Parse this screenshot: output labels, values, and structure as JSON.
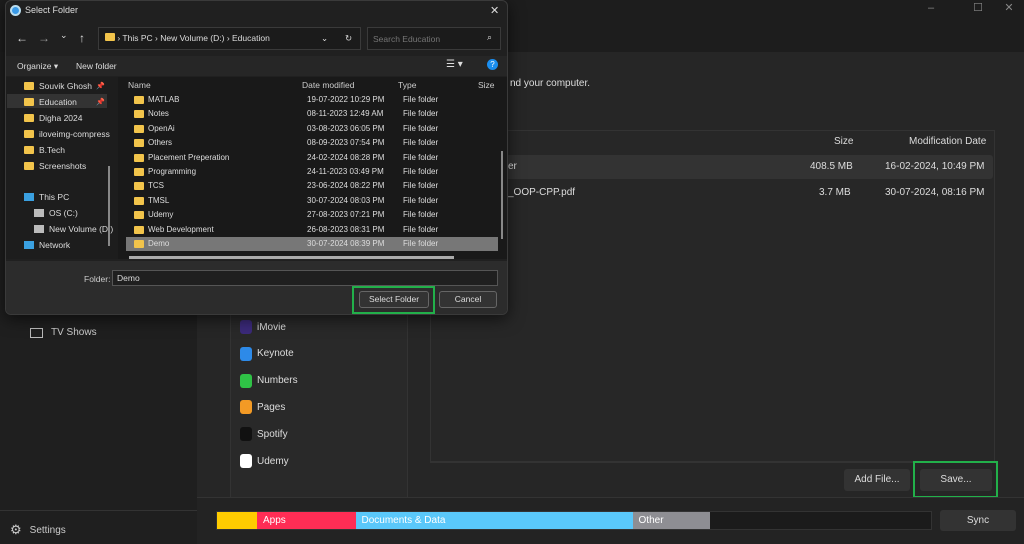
{
  "app": {
    "window_controls": [
      "minimize",
      "maximize",
      "close"
    ],
    "description_fragment": "nd your computer.",
    "sidebar": {
      "tv_shows": "TV Shows",
      "settings": "Settings"
    },
    "apps": [
      "iMovie",
      "Keynote",
      "Numbers",
      "Pages",
      "Spotify",
      "Udemy"
    ],
    "app_colors": [
      "#3b2a7a",
      "#2d8ae8",
      "#2fc246",
      "#f39a25",
      "#111111",
      "#ffffff"
    ],
    "table": {
      "headers": {
        "size": "Size",
        "date": "Modification Date"
      },
      "rows": [
        {
          "name": "er",
          "size": "408.5 MB",
          "date": "16-02-2024, 10:49 PM"
        },
        {
          "name": "_OOP-CPP.pdf",
          "size": "3.7 MB",
          "date": "30-07-2024, 08:16 PM"
        }
      ]
    },
    "add_file": "Add File...",
    "save": "Save...",
    "sync": "Sync",
    "storage": [
      {
        "label": "",
        "color": "#ffcc00",
        "percent": 5.6
      },
      {
        "label": "Apps",
        "color": "#ff2d55",
        "percent": 13.8
      },
      {
        "label": "Documents & Data",
        "color": "#5ac8fa",
        "percent": 38.8
      },
      {
        "label": "Other",
        "color": "#8e8e93",
        "percent": 10.8
      }
    ]
  },
  "dialog": {
    "title": "Select Folder",
    "breadcrumb": [
      "This PC",
      "New Volume (D:)",
      "Education"
    ],
    "search_placeholder": "Search Education",
    "organize": "Organize",
    "new_folder": "New folder",
    "nav_pane": {
      "quick": [
        {
          "label": "Souvik Ghosh",
          "pinned": true
        },
        {
          "label": "Education",
          "pinned": true,
          "selected": true
        },
        {
          "label": "Digha 2024"
        },
        {
          "label": "iloveimg-compress"
        },
        {
          "label": "B.Tech"
        },
        {
          "label": "Screenshots"
        }
      ],
      "this_pc": "This PC",
      "drives": [
        "OS (C:)",
        "New Volume (D:)"
      ],
      "network": "Network"
    },
    "columns": {
      "name": "Name",
      "date": "Date modified",
      "type": "Type",
      "size": "Size"
    },
    "files": [
      {
        "name": "MATLAB",
        "date": "19-07-2022 10:29 PM",
        "type": "File folder"
      },
      {
        "name": "Notes",
        "date": "08-11-2023 12:49 AM",
        "type": "File folder"
      },
      {
        "name": "OpenAi",
        "date": "03-08-2023 06:05 PM",
        "type": "File folder"
      },
      {
        "name": "Others",
        "date": "08-09-2023 07:54 PM",
        "type": "File folder"
      },
      {
        "name": "Placement Preperation",
        "date": "24-02-2024 08:28 PM",
        "type": "File folder"
      },
      {
        "name": "Programming",
        "date": "24-11-2023 03:49 PM",
        "type": "File folder"
      },
      {
        "name": "TCS",
        "date": "23-06-2024 08:22 PM",
        "type": "File folder"
      },
      {
        "name": "TMSL",
        "date": "30-07-2024 08:03 PM",
        "type": "File folder"
      },
      {
        "name": "Udemy",
        "date": "27-08-2023 07:21 PM",
        "type": "File folder"
      },
      {
        "name": "Web Development",
        "date": "26-08-2023 08:31 PM",
        "type": "File folder"
      },
      {
        "name": "Demo",
        "date": "30-07-2024 08:39 PM",
        "type": "File folder",
        "selected": true
      }
    ],
    "folder_label": "Folder:",
    "folder_value": "Demo",
    "select_folder": "Select Folder",
    "cancel": "Cancel"
  }
}
